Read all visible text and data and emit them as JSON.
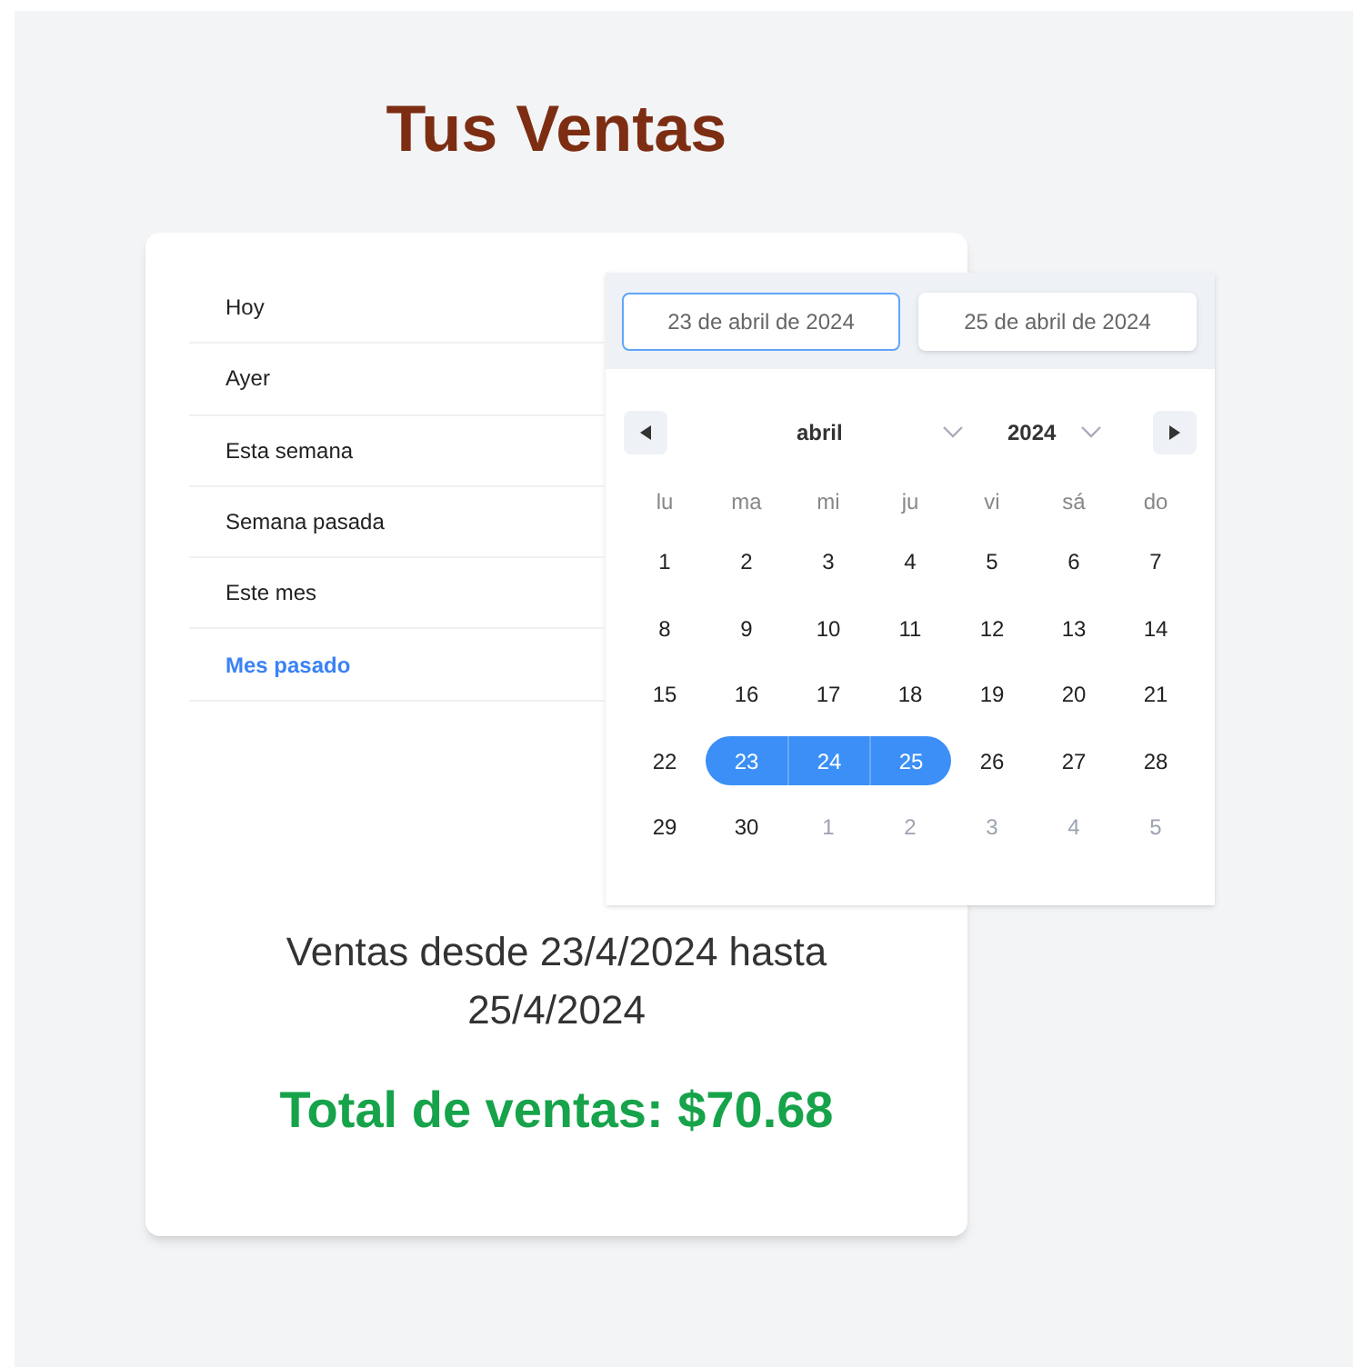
{
  "title": "Tus Ventas",
  "presets": [
    {
      "label": "Hoy",
      "selected": false
    },
    {
      "label": "Ayer",
      "selected": false
    },
    {
      "label": "Esta semana",
      "selected": false
    },
    {
      "label": "Semana pasada",
      "selected": false
    },
    {
      "label": "Este mes",
      "selected": false
    },
    {
      "label": "Mes pasado",
      "selected": true
    }
  ],
  "date_picker": {
    "start_field": {
      "value": "23 de abril de 2024",
      "focused": true
    },
    "end_field": {
      "value": "25 de abril de 2024",
      "focused": false
    },
    "month": "abril",
    "year": "2024",
    "weekdays": [
      "lu",
      "ma",
      "mi",
      "ju",
      "vi",
      "sá",
      "do"
    ],
    "days": [
      {
        "label": "1",
        "selected": false,
        "outside": false
      },
      {
        "label": "2",
        "selected": false,
        "outside": false
      },
      {
        "label": "3",
        "selected": false,
        "outside": false
      },
      {
        "label": "4",
        "selected": false,
        "outside": false
      },
      {
        "label": "5",
        "selected": false,
        "outside": false
      },
      {
        "label": "6",
        "selected": false,
        "outside": false
      },
      {
        "label": "7",
        "selected": false,
        "outside": false
      },
      {
        "label": "8",
        "selected": false,
        "outside": false
      },
      {
        "label": "9",
        "selected": false,
        "outside": false
      },
      {
        "label": "10",
        "selected": false,
        "outside": false
      },
      {
        "label": "11",
        "selected": false,
        "outside": false
      },
      {
        "label": "12",
        "selected": false,
        "outside": false
      },
      {
        "label": "13",
        "selected": false,
        "outside": false
      },
      {
        "label": "14",
        "selected": false,
        "outside": false
      },
      {
        "label": "15",
        "selected": false,
        "outside": false
      },
      {
        "label": "16",
        "selected": false,
        "outside": false
      },
      {
        "label": "17",
        "selected": false,
        "outside": false
      },
      {
        "label": "18",
        "selected": false,
        "outside": false
      },
      {
        "label": "19",
        "selected": false,
        "outside": false
      },
      {
        "label": "20",
        "selected": false,
        "outside": false
      },
      {
        "label": "21",
        "selected": false,
        "outside": false
      },
      {
        "label": "22",
        "selected": false,
        "outside": false
      },
      {
        "label": "23",
        "selected": true,
        "outside": false
      },
      {
        "label": "24",
        "selected": true,
        "outside": false
      },
      {
        "label": "25",
        "selected": true,
        "outside": false
      },
      {
        "label": "26",
        "selected": false,
        "outside": false
      },
      {
        "label": "27",
        "selected": false,
        "outside": false
      },
      {
        "label": "28",
        "selected": false,
        "outside": false
      },
      {
        "label": "29",
        "selected": false,
        "outside": false
      },
      {
        "label": "30",
        "selected": false,
        "outside": false
      },
      {
        "label": "1",
        "selected": false,
        "outside": true
      },
      {
        "label": "2",
        "selected": false,
        "outside": true
      },
      {
        "label": "3",
        "selected": false,
        "outside": true
      },
      {
        "label": "4",
        "selected": false,
        "outside": true
      },
      {
        "label": "5",
        "selected": false,
        "outside": true
      }
    ]
  },
  "range_text": "Ventas desde 23/4/2024 hasta 25/4/2024",
  "total_text": "Total de ventas: $70.68"
}
